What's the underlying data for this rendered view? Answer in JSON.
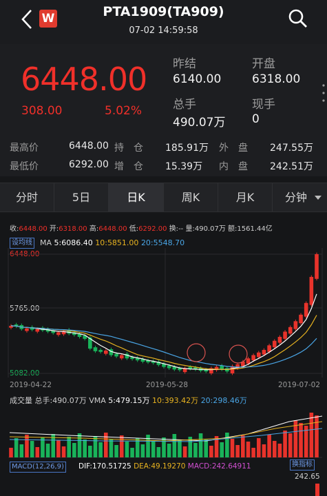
{
  "header": {
    "title": "PTA1909(TA909)",
    "datetime": "07-02 14:59:58",
    "logo_text": "W"
  },
  "quote": {
    "price": "6448.00",
    "change": "308.00",
    "change_pct": "5.02%",
    "prev_close_label": "昨结",
    "prev_close": "6140.00",
    "open_label": "开盘",
    "open": "6318.00",
    "volume_label": "总手",
    "volume": "490.07万",
    "current_label": "现手",
    "current": "0"
  },
  "stats": [
    {
      "l1": "最高价",
      "v1": "6448.00",
      "l2": "持　仓",
      "v2": "185.91万",
      "l3": "外　盘",
      "v3": "247.55万"
    },
    {
      "l1": "最低价",
      "v1": "6292.00",
      "l2": "增　仓",
      "v2": "15.39万",
      "l3": "内　盘",
      "v3": "242.51万"
    }
  ],
  "tabs": [
    "分时",
    "5日",
    "日K",
    "周K",
    "月K",
    "分钟"
  ],
  "active_tab": "日K",
  "chart": {
    "ohlc": {
      "close_label": "收:",
      "close": "6448.00",
      "open_label": "开:",
      "open": "6318.00",
      "high_label": "高:",
      "high": "6448.00",
      "low_label": "低:",
      "low": "6292.00",
      "turnover_label": "换:",
      "turnover": "--",
      "volume_label": "量:",
      "volume": "490.07万",
      "amount_label": "额:",
      "amount": "1561.44亿"
    },
    "ma_setting": "设均线",
    "ma": {
      "label": "MA",
      "ma5_label": "5:",
      "ma5": "6086.40",
      "ma10_label": "10:",
      "ma10": "5851.00",
      "ma20_label": "20:",
      "ma20": "5548.70"
    },
    "y_labels": {
      "top": "6448.00",
      "mid": "5765.00",
      "bottom": "5082.00"
    },
    "x_labels": [
      "2019-04-22",
      "2019-05-28",
      "2019-07-02"
    ],
    "vol": {
      "label": "成交量",
      "total_label": "总手:",
      "total": "490.07万",
      "vma": "VMA",
      "v5_label": "5:",
      "v5": "479.15万",
      "v10_label": "10:",
      "v10": "393.42万",
      "v20_label": "20:",
      "v20": "298.46万"
    },
    "macd": {
      "label": "MACD(12,26,9)",
      "dif_label": "DIF:",
      "dif": "170.51725",
      "dea_label": "DEA:",
      "dea": "49.19270",
      "macd_label": "MACD:",
      "macd": "242.64911",
      "switch": "换指标",
      "scale": "242.65"
    },
    "colors": {
      "up": "#e8332b",
      "down": "#19b35a",
      "ma5": "#ffffff",
      "ma10": "#e8b320",
      "ma20": "#4aa6e6",
      "price": "#f0302a"
    }
  }
}
